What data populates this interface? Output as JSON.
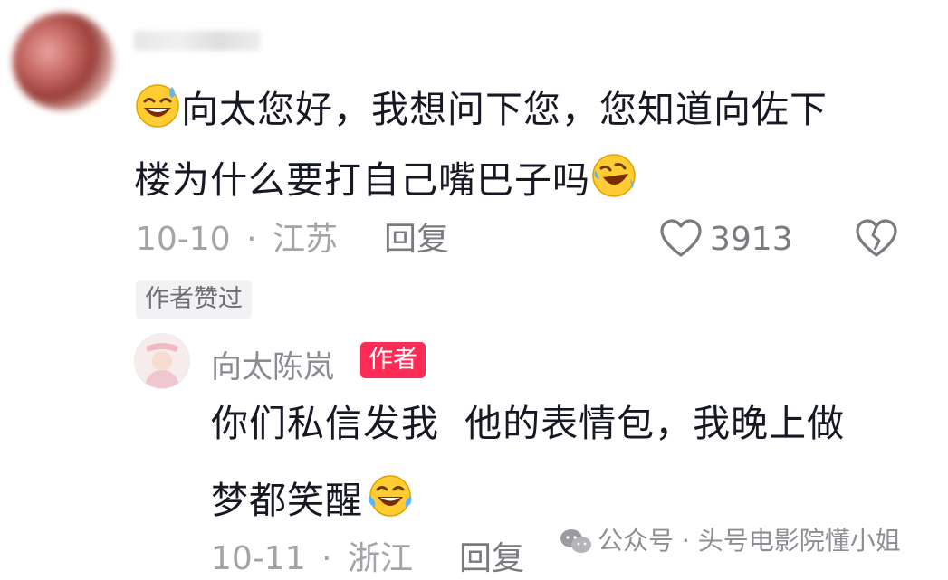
{
  "comment": {
    "line1": "向太您好，我想问下您，您知道向佐下",
    "line2": "楼为什么要打自己嘴巴子吗",
    "date": "10-10",
    "separator": "·",
    "location": "江苏",
    "reply_label": "回复",
    "like_count": "3913",
    "author_liked": "作者赞过"
  },
  "reply": {
    "author_name": "向太陈岚",
    "author_badge": "作者",
    "line1": "你们私信发我  他的表情包，我晚上做",
    "line2": "梦都笑醒",
    "date": "10-11",
    "separator": "·",
    "location": "浙江",
    "reply_label": "回复"
  },
  "watermark": {
    "text": "公众号 · 头号电影院懂小姐"
  },
  "icons": {
    "emoji_1": "laughing-sweat-emoji-icon",
    "emoji_2": "rolling-laughing-emoji-icon",
    "emoji_3": "laughing-tears-emoji-icon",
    "like": "heart-outline-icon",
    "dislike": "broken-heart-icon",
    "wechat": "wechat-logo-icon"
  },
  "colors": {
    "badge": "#fe2c55",
    "meta": "#a3a4a8",
    "text": "#161823"
  }
}
